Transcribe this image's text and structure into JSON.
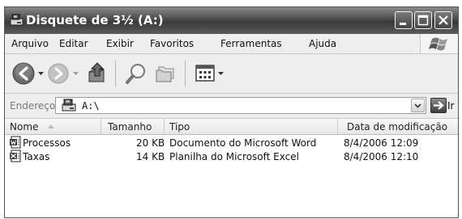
{
  "window": {
    "title": "Disquete de 3½ (A:)"
  },
  "menu": {
    "items": [
      "Arquivo",
      "Editar",
      "Exibir",
      "Favoritos",
      "Ferramentas",
      "Ajuda"
    ]
  },
  "address": {
    "label": "Endereço",
    "value": "A:\\",
    "go_label": "Ir"
  },
  "list": {
    "columns": [
      "Nome",
      "Tamanho",
      "Tipo",
      "Data de modificação"
    ],
    "rows": [
      {
        "name": "Processos",
        "size": "20 KB",
        "type": "Documento do Microsoft Word",
        "date": "8/4/2006 12:09",
        "icon": "word-document-icon"
      },
      {
        "name": "Taxas",
        "size": "14 KB",
        "type": "Planilha do Microsoft Excel",
        "date": "8/4/2006 12:10",
        "icon": "excel-spreadsheet-icon"
      }
    ]
  }
}
